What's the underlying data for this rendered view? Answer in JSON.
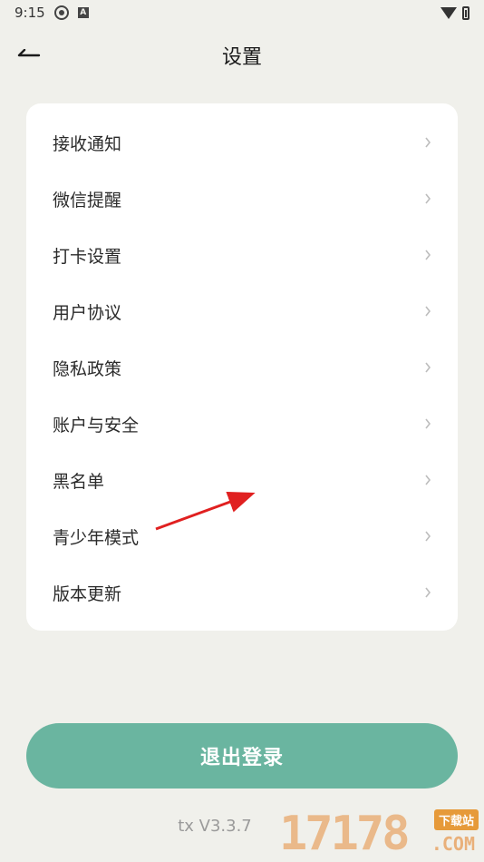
{
  "status_bar": {
    "time": "9:15",
    "a_badge": "A"
  },
  "header": {
    "title": "设置"
  },
  "settings": {
    "items": [
      {
        "label": "接收通知"
      },
      {
        "label": "微信提醒"
      },
      {
        "label": "打卡设置"
      },
      {
        "label": "用户协议"
      },
      {
        "label": "隐私政策"
      },
      {
        "label": "账户与安全"
      },
      {
        "label": "黑名单"
      },
      {
        "label": "青少年模式"
      },
      {
        "label": "版本更新"
      }
    ]
  },
  "logout_label": "退出登录",
  "version": "tx V3.3.7",
  "watermark": {
    "digits": "17178",
    "badge": "下载站",
    "suffix": ".COM"
  },
  "colors": {
    "background": "#f0f0eb",
    "card": "#ffffff",
    "accent": "#6ab5a0",
    "annotation": "#e02020"
  }
}
